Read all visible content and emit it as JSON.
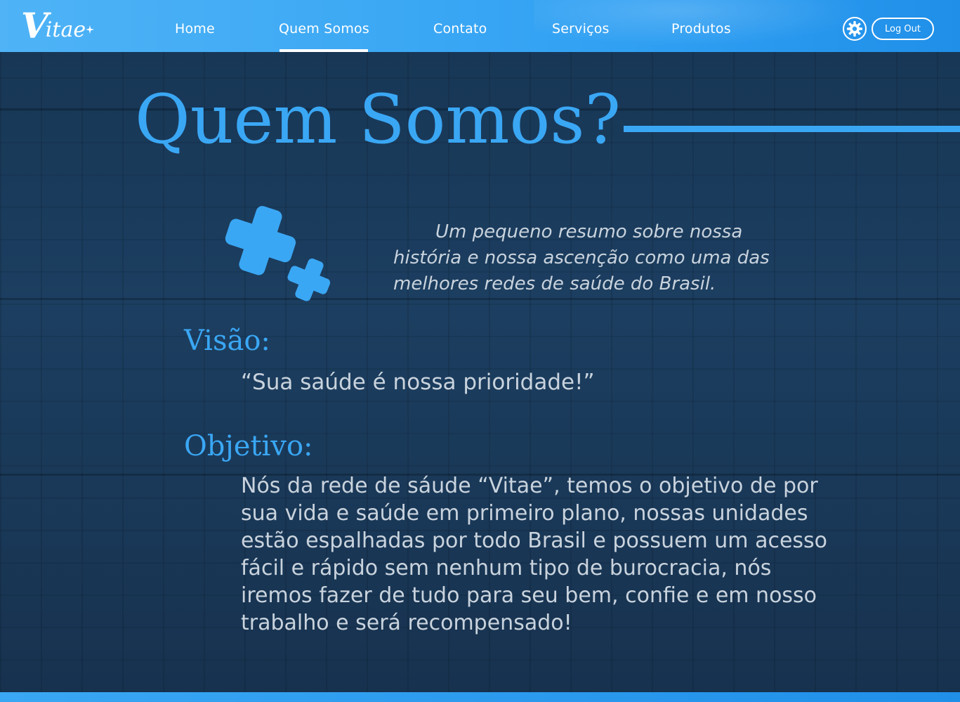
{
  "brand": {
    "logo_big": "V",
    "logo_rest": "itae",
    "logo_color": "#ffffff"
  },
  "nav": {
    "items": [
      {
        "label": "Home"
      },
      {
        "label": "Quem Somos",
        "active": true
      },
      {
        "label": "Contato"
      },
      {
        "label": "Serviços"
      },
      {
        "label": "Produtos"
      }
    ],
    "logout_label": "Log Out",
    "settings_icon": "gear-icon"
  },
  "page": {
    "title": "Quem Somos?",
    "intro": "Um pequeno resumo sobre nossa história e nossa ascenção como uma das melhores redes de saúde do Brasil.",
    "vision_heading": "Visão:",
    "vision_text": "“Sua saúde é nossa prioridade!”",
    "objective_heading": "Objetivo:",
    "objective_text": "Nós da rede de sáude “Vitae”, temos o objetivo de por sua vida e saúde em primeiro plano, nossas unidades estão espalhadas por todo Brasil e possuem um acesso fácil e rápido sem nenhum tipo de burocracia, nós iremos fazer de tudo para seu bem, confie e em nosso trabalho e será recompensado!"
  },
  "colors": {
    "accent": "#3aa7f4",
    "header_start": "#4fb3f6",
    "header_end": "#1f8fe8",
    "background": "#1a3a5c",
    "body_text": "#c9d3dd"
  }
}
